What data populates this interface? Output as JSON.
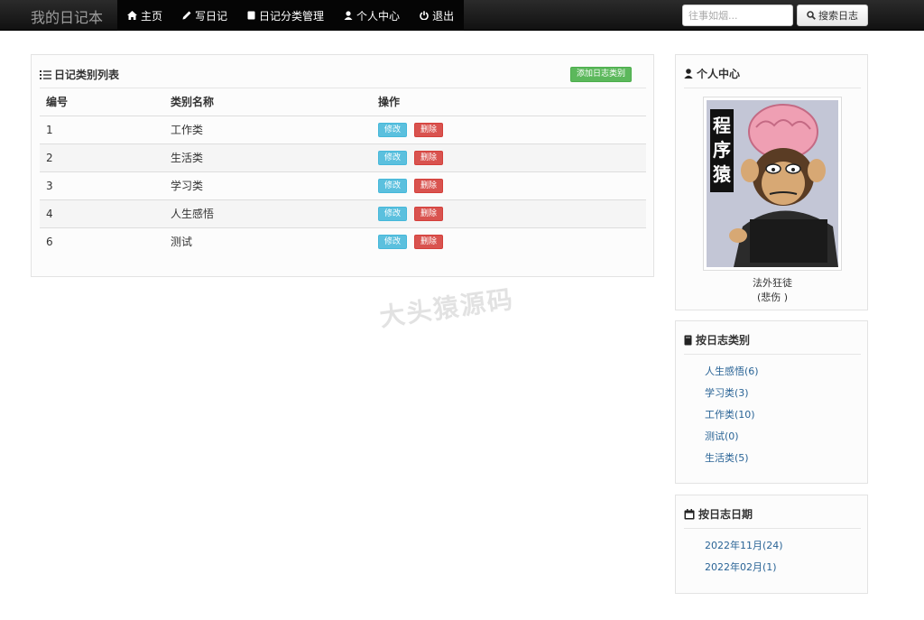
{
  "navbar": {
    "brand": "我的日记本",
    "items": [
      {
        "label": "主页",
        "icon": "home-icon"
      },
      {
        "label": "写日记",
        "icon": "pencil-icon"
      },
      {
        "label": "日记分类管理",
        "icon": "book-icon"
      },
      {
        "label": "个人中心",
        "icon": "user-icon"
      },
      {
        "label": "退出",
        "icon": "power-icon"
      }
    ],
    "search_placeholder": "往事如烟...",
    "search_button": "搜索日志"
  },
  "main": {
    "title": "日记类别列表",
    "add_button": "添加日志类别",
    "columns": [
      "编号",
      "类别名称",
      "操作"
    ],
    "rows": [
      {
        "id": "1",
        "name": "工作类"
      },
      {
        "id": "2",
        "name": "生活类"
      },
      {
        "id": "3",
        "name": "学习类"
      },
      {
        "id": "4",
        "name": "人生感悟"
      },
      {
        "id": "6",
        "name": "测试"
      }
    ],
    "edit_label": "修改",
    "delete_label": "删除"
  },
  "watermark": "大头猿源码",
  "sidebar": {
    "profile": {
      "title": "个人中心",
      "avatar_text": "程序猿",
      "nickname": "法外狂徒",
      "mood": "(悲伤 )"
    },
    "categories": {
      "title": "按日志类别",
      "items": [
        "人生感悟(6)",
        "学习类(3)",
        "工作类(10)",
        "测试(0)",
        "生活类(5)"
      ]
    },
    "dates": {
      "title": "按日志日期",
      "items": [
        "2022年11月(24)",
        "2022年02月(1)"
      ]
    }
  },
  "colors": {
    "navbar": "#111111",
    "success": "#5cb85c",
    "info": "#5bc0de",
    "danger": "#d9534f",
    "link": "#2a6496"
  }
}
